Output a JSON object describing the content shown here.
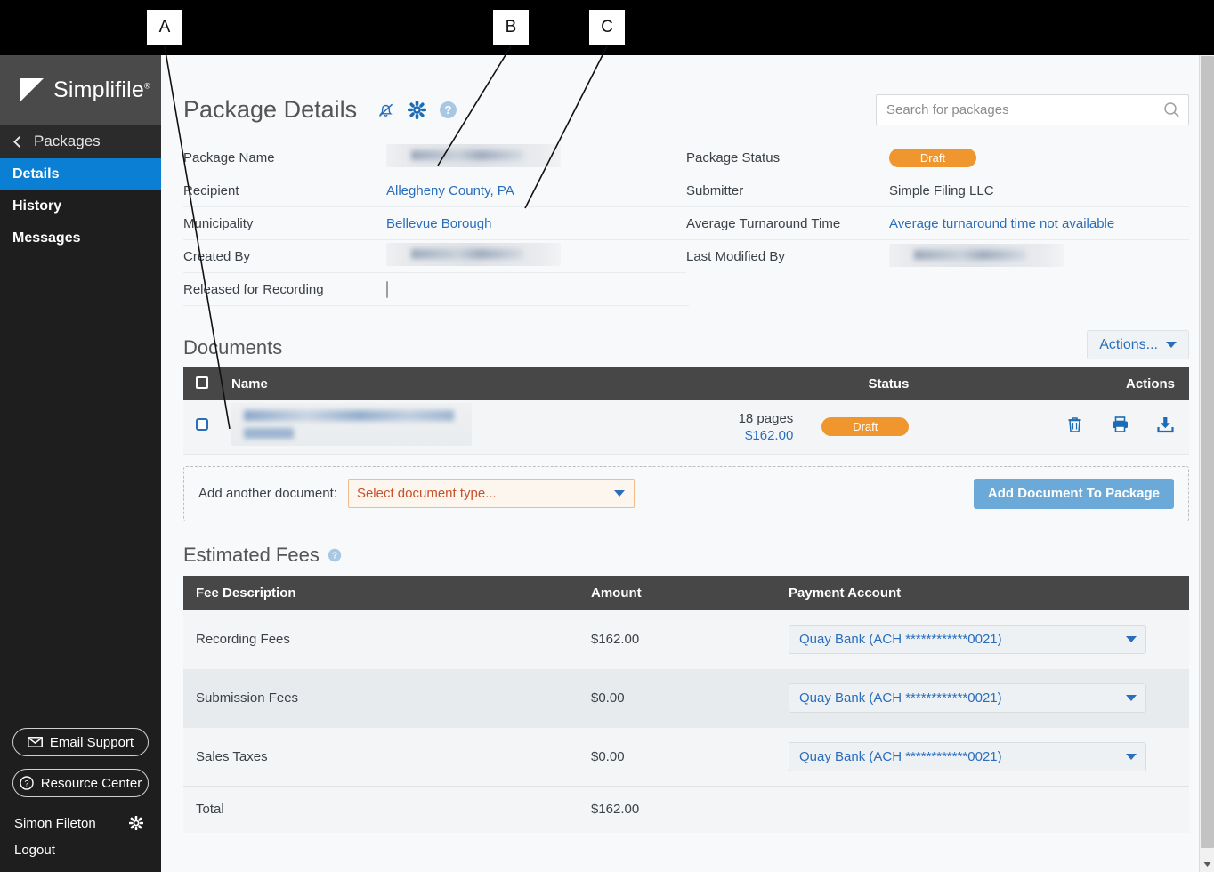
{
  "callouts": [
    {
      "label": "A"
    },
    {
      "label": "B"
    },
    {
      "label": "C"
    }
  ],
  "sidebar": {
    "logo_text": "Simplifile",
    "logo_reg": "®",
    "back_label": "Packages",
    "items": [
      {
        "label": "Details",
        "active": true
      },
      {
        "label": "History",
        "active": false
      },
      {
        "label": "Messages",
        "active": false
      }
    ],
    "email_support": "Email Support",
    "resource_center": "Resource Center",
    "user_name": "Simon Fileton",
    "logout": "Logout"
  },
  "header": {
    "title": "Package Details",
    "icons": [
      "bell-off-icon",
      "gear-icon",
      "help-icon"
    ]
  },
  "search": {
    "placeholder": "Search for packages",
    "value": ""
  },
  "details": {
    "left": [
      {
        "label": "Package Name",
        "value": "",
        "redacted": true
      },
      {
        "label": "Recipient",
        "value": "Allegheny County, PA",
        "link": true
      },
      {
        "label": "Municipality",
        "value": "Bellevue Borough",
        "link": true
      },
      {
        "label": "Created By",
        "value": "",
        "redacted": true
      },
      {
        "label": "Released for Recording",
        "value": "",
        "checkbox": true,
        "checked": false
      }
    ],
    "right": [
      {
        "label": "Package Status",
        "value": "Draft",
        "badge": true
      },
      {
        "label": "Submitter",
        "value": "Simple Filing LLC"
      },
      {
        "label": "Average Turnaround Time",
        "value": "Average turnaround time not available",
        "link": true
      },
      {
        "label": "Last Modified By",
        "value": "",
        "redacted": true
      }
    ]
  },
  "documents": {
    "section_title": "Documents",
    "actions_button": "Actions...",
    "columns": [
      "",
      "Name",
      "Status",
      "Actions"
    ],
    "rows": [
      {
        "name": "",
        "redacted": true,
        "pages": "18 pages",
        "amount": "$162.00",
        "status": "Draft",
        "actions": [
          "trash-icon",
          "print-icon",
          "download-icon"
        ]
      }
    ],
    "add_label": "Add another document:",
    "add_select_value": "Select document type...",
    "add_button": "Add Document To Package"
  },
  "fees": {
    "section_title": "Estimated Fees",
    "columns": [
      "Fee Description",
      "Amount",
      "Payment Account"
    ],
    "rows": [
      {
        "description": "Recording Fees",
        "amount": "$162.00",
        "account": "Quay Bank (ACH ************0021)"
      },
      {
        "description": "Submission Fees",
        "amount": "$0.00",
        "account": "Quay Bank (ACH ************0021)"
      },
      {
        "description": "Sales Taxes",
        "amount": "$0.00",
        "account": "Quay Bank (ACH ************0021)"
      }
    ],
    "total_label": "Total",
    "total_amount": "$162.00"
  },
  "colors": {
    "accent_blue": "#2a6ebb",
    "nav_active": "#0b7fd4",
    "status_orange": "#f0962e",
    "table_header": "#474747",
    "sidebar": "#1e1e1e"
  }
}
